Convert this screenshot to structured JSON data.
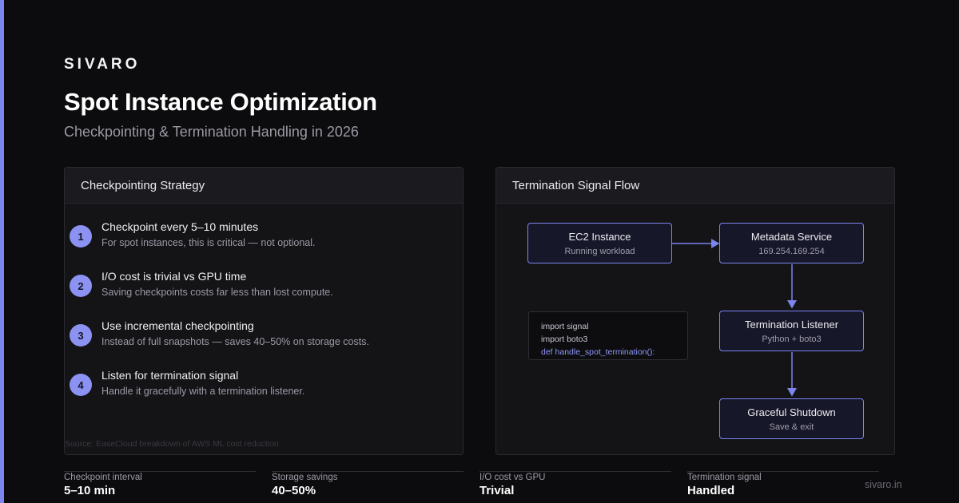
{
  "brand": "SIVARO",
  "title": "Spot Instance Optimization",
  "subtitle": "Checkpointing & Termination Handling in 2026",
  "colors": {
    "background": "#0c0c0e",
    "accent": "#7d86f0",
    "panel": "#141417",
    "node_border": "#7c84ee"
  },
  "left_panel": {
    "heading": "Checkpointing Strategy",
    "steps": [
      {
        "number": "1",
        "title": "Checkpoint every 5–10 minutes",
        "desc": "For spot instances, this is critical — not optional."
      },
      {
        "number": "2",
        "title": "I/O cost is trivial vs GPU time",
        "desc": "Saving checkpoints costs far less than lost compute."
      },
      {
        "number": "3",
        "title": "Use incremental checkpointing",
        "desc": "Instead of full snapshots — saves 40–50% on storage costs."
      },
      {
        "number": "4",
        "title": "Listen for termination signal",
        "desc": "Handle it gracefully with a termination listener."
      }
    ],
    "source": "Source: EaseCloud breakdown of AWS ML cost reduction"
  },
  "right_panel": {
    "heading": "Termination Signal Flow",
    "nodes": [
      {
        "title": "EC2 Instance",
        "sub": "Running workload"
      },
      {
        "title": "Metadata Service",
        "sub": "169.254.169.254"
      },
      {
        "title": "Termination Listener",
        "sub": "Python + boto3"
      },
      {
        "title": "Graceful Shutdown",
        "sub": "Save & exit"
      }
    ],
    "code_lines": [
      "import signal",
      "import boto3",
      "def handle_spot_termination():"
    ]
  },
  "stats": [
    {
      "label": "Checkpoint interval",
      "value": "5–10 min"
    },
    {
      "label": "Storage savings",
      "value": "40–50%"
    },
    {
      "label": "I/O cost vs GPU",
      "value": "Trivial"
    },
    {
      "label": "Termination signal",
      "value": "Handled"
    }
  ],
  "footer_url": "sivaro.in"
}
